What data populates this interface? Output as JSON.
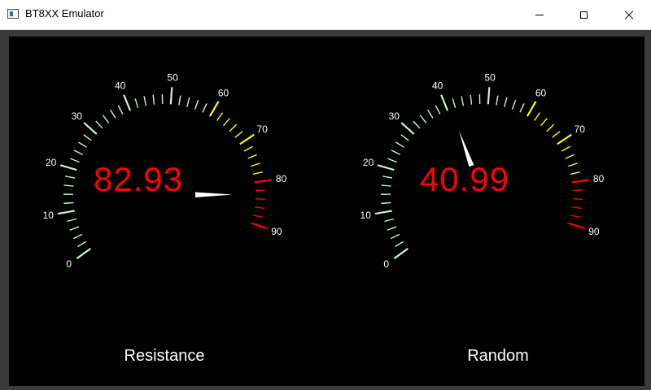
{
  "window": {
    "title": "BT8XX Emulator",
    "buttons": [
      "minimize",
      "maximize",
      "close"
    ]
  },
  "gauge_scale": {
    "labels": [
      "0",
      "10",
      "20",
      "30",
      "40",
      "50",
      "60",
      "70",
      "80",
      "90"
    ],
    "min": 0,
    "max": 90,
    "yellow_from": 60,
    "red_from": 80,
    "colors": {
      "green": "#ccf5cc",
      "yellow": "#ffff00",
      "red": "#ff0000",
      "needle": "#ffffff",
      "readout": "#ff0000"
    }
  },
  "gauges": [
    {
      "name": "Resistance",
      "value": 82.93,
      "display": "82.93"
    },
    {
      "name": "Random",
      "value": 40.99,
      "display": "40.99"
    }
  ]
}
